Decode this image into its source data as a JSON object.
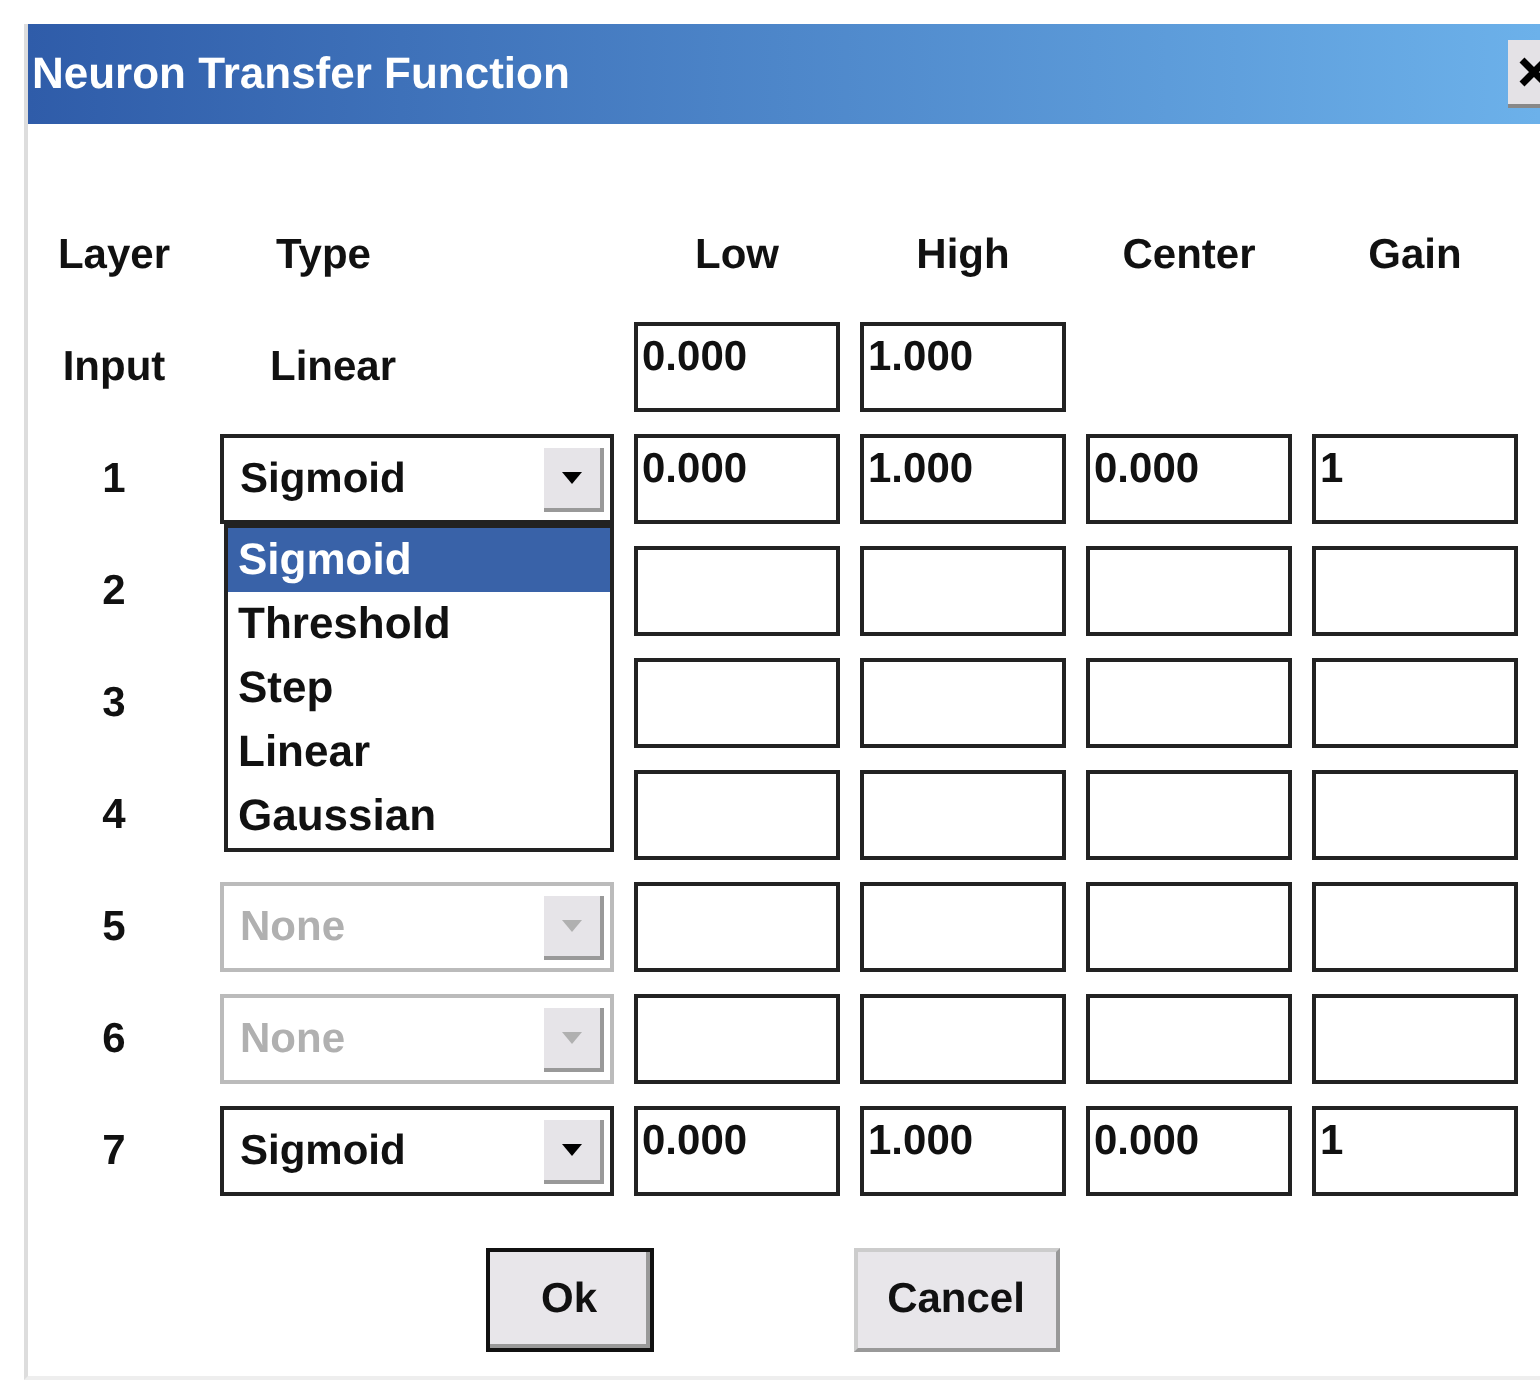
{
  "window": {
    "title": "Neuron Transfer Function"
  },
  "columns": [
    "Layer",
    "Type",
    "Low",
    "High",
    "Center",
    "Gain"
  ],
  "input_row": {
    "layer": "Input",
    "type": "Linear",
    "low": "0.000",
    "high": "1.000"
  },
  "layers": [
    {
      "layer": "1",
      "type": "Sigmoid",
      "disabled": false,
      "low": "0.000",
      "high": "1.000",
      "center": "0.000",
      "gain": "1",
      "dropdown_open": true,
      "options": [
        {
          "label": "Sigmoid",
          "selected": true
        },
        {
          "label": "Threshold",
          "selected": false
        },
        {
          "label": "Step",
          "selected": false
        },
        {
          "label": "Linear",
          "selected": false
        },
        {
          "label": "Gaussian",
          "selected": false
        }
      ]
    },
    {
      "layer": "2"
    },
    {
      "layer": "3"
    },
    {
      "layer": "4"
    },
    {
      "layer": "5",
      "type": "None",
      "disabled": true
    },
    {
      "layer": "6",
      "type": "None",
      "disabled": true
    },
    {
      "layer": "7",
      "type": "Sigmoid",
      "disabled": false,
      "low": "0.000",
      "high": "1.000",
      "center": "0.000",
      "gain": "1"
    }
  ],
  "buttons": [
    {
      "label": "Ok",
      "default": true
    },
    {
      "label": "Cancel",
      "default": false
    }
  ]
}
